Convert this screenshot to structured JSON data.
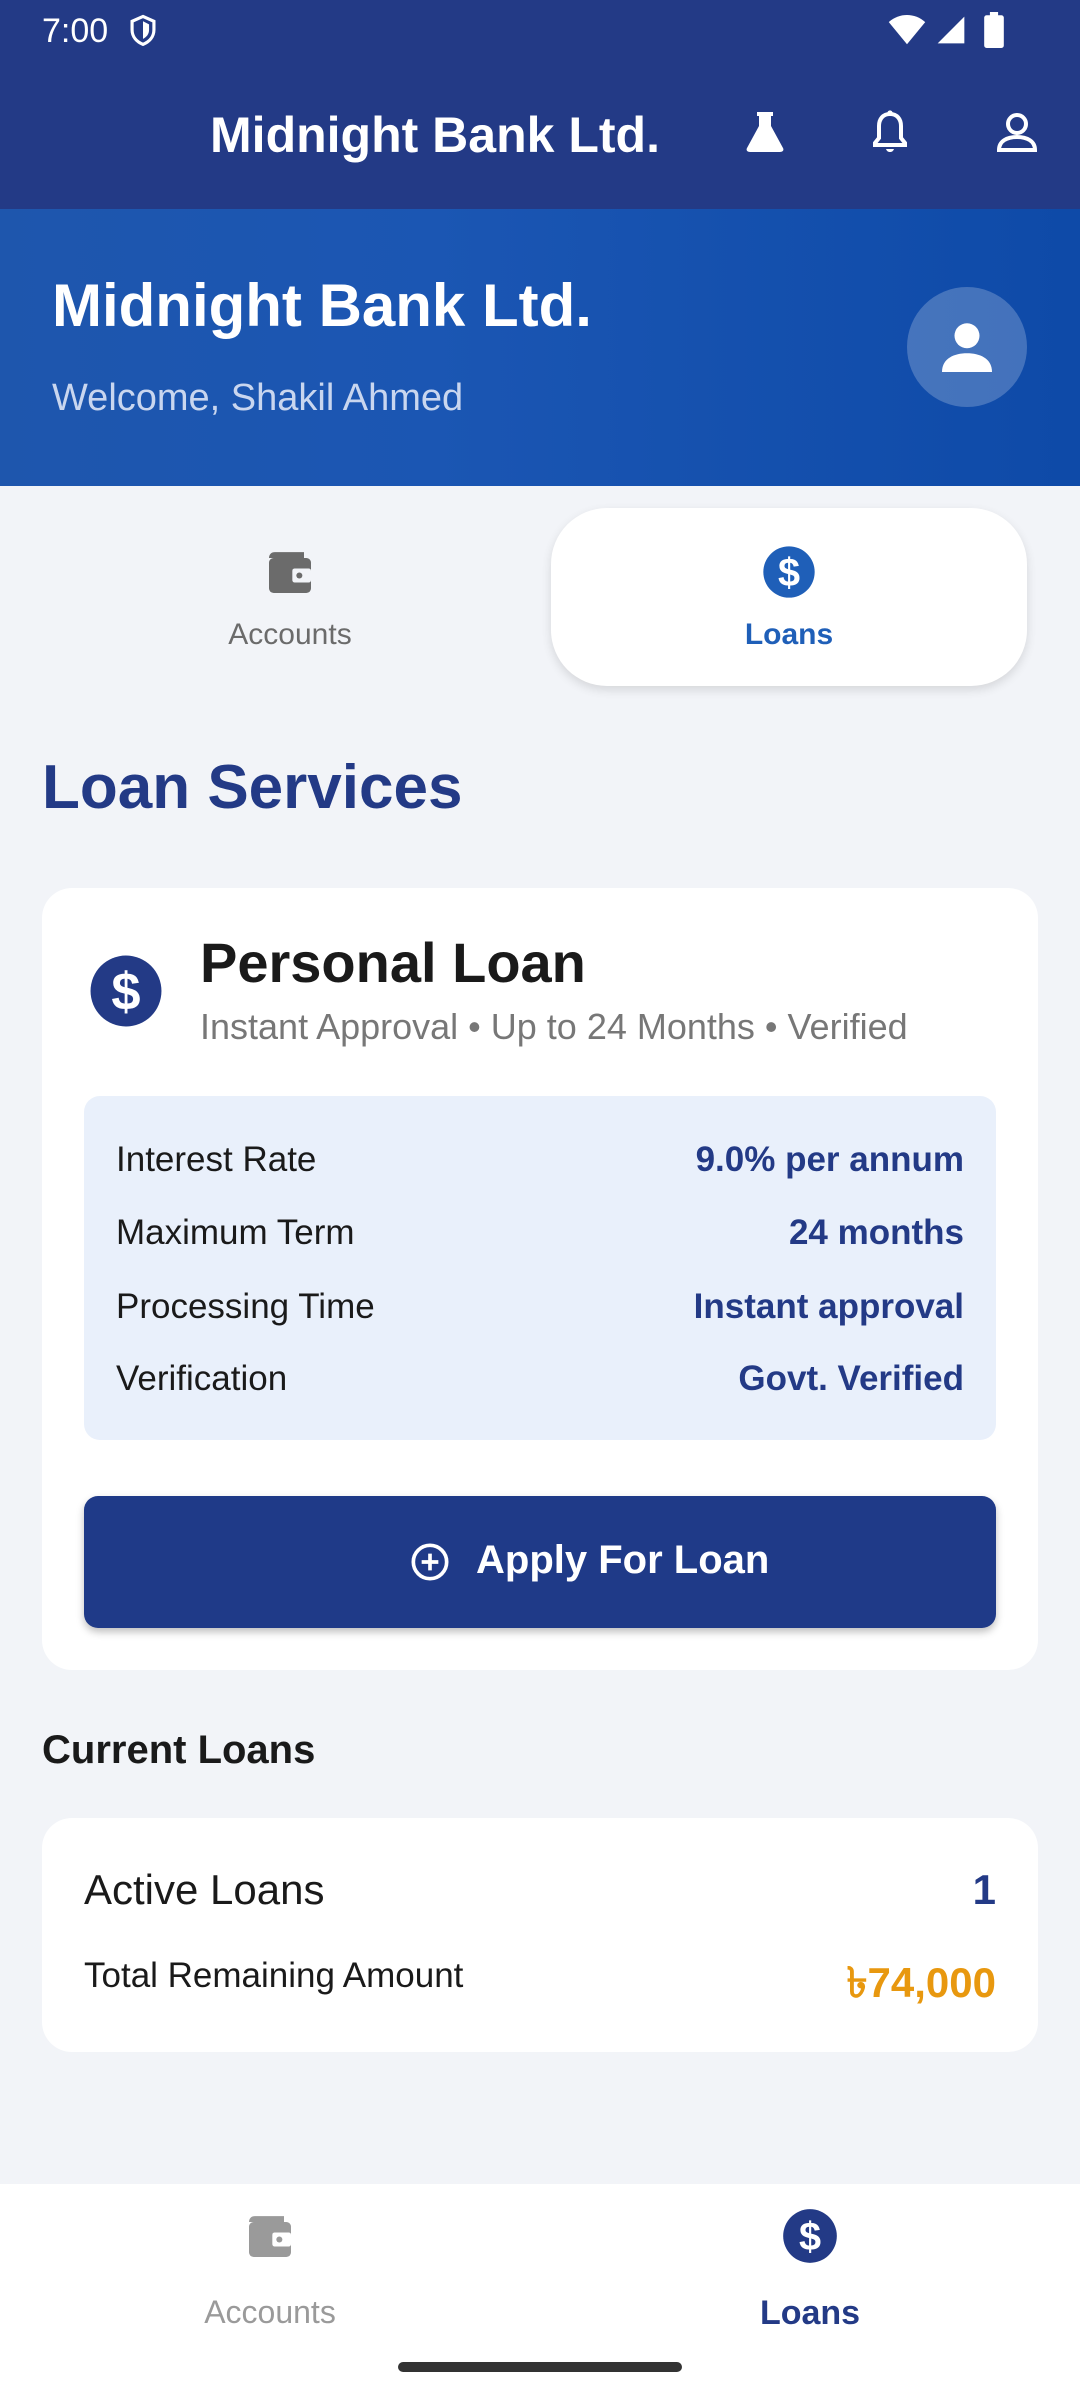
{
  "status_bar": {
    "time": "7:00"
  },
  "app_bar": {
    "title": "Midnight Bank Ltd."
  },
  "header": {
    "bank_name": "Midnight Bank Ltd.",
    "welcome": "Welcome, Shakil Ahmed"
  },
  "tabs": [
    {
      "label": "Accounts",
      "icon": "wallet-icon",
      "selected": false
    },
    {
      "label": "Loans",
      "icon": "dollar-circle-icon",
      "selected": true
    }
  ],
  "section_title": "Loan Services",
  "loan_card": {
    "title": "Personal Loan",
    "subtitle": "Instant Approval • Up to 24 Months • Verified",
    "details": [
      {
        "key": "Interest Rate",
        "value": "9.0% per annum"
      },
      {
        "key": "Maximum Term",
        "value": "24 months"
      },
      {
        "key": "Processing Time",
        "value": "Instant approval"
      },
      {
        "key": "Verification",
        "value": "Govt. Verified"
      }
    ],
    "apply_label": "Apply For Loan"
  },
  "current_loans": {
    "title": "Current Loans",
    "active_label": "Active Loans",
    "active_count": "1",
    "remaining_label": "Total Remaining Amount",
    "remaining_amount": "৳74,000"
  },
  "bottom_nav": [
    {
      "label": "Accounts",
      "icon": "wallet-icon",
      "selected": false
    },
    {
      "label": "Loans",
      "icon": "dollar-circle-icon",
      "selected": true
    }
  ],
  "colors": {
    "primary": "#233a86",
    "accent_blue": "#1f5fb8",
    "amount_orange": "#e8980f",
    "background": "#f2f4f8"
  }
}
